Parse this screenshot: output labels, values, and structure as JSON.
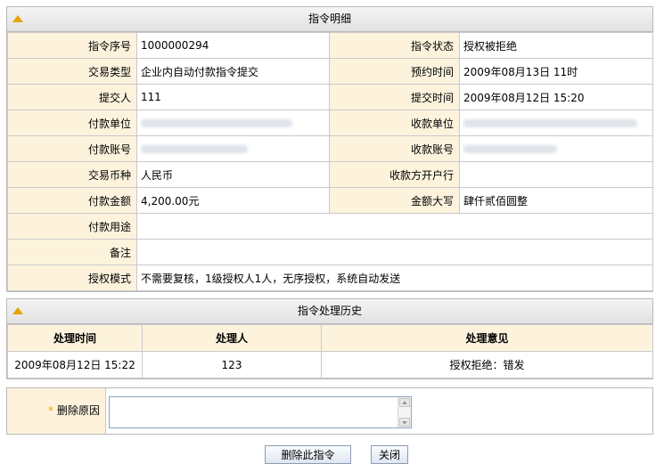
{
  "detail": {
    "title": "指令明细",
    "rows": [
      {
        "l1": "指令序号",
        "v1": "1000000294",
        "l2": "指令状态",
        "v2": "授权被拒绝"
      },
      {
        "l1": "交易类型",
        "v1": "企业内自动付款指令提交",
        "l2": "预约时间",
        "v2": "2009年08月13日 11时"
      },
      {
        "l1": "提交人",
        "v1": "111",
        "l2": "提交时间",
        "v2": "2009年08月12日 15:20"
      },
      {
        "l1": "付款单位",
        "v1": "",
        "l2": "收款单位",
        "v2": ""
      },
      {
        "l1": "付款账号",
        "v1": "",
        "l2": "收款账号",
        "v2": ""
      },
      {
        "l1": "交易币种",
        "v1": "人民币",
        "l2": "收款方开户行",
        "v2": ""
      },
      {
        "l1": "付款金额",
        "v1": "4,200.00元",
        "l2": "金额大写",
        "v2": "肆仟贰佰圆整"
      }
    ],
    "purpose_label": "付款用途",
    "purpose_value": "",
    "remark_label": "备注",
    "remark_value": "",
    "auth_label": "授权模式",
    "auth_value": "不需要复核，1级授权人1人，无序授权，系统自动发送"
  },
  "history": {
    "title": "指令处理历史",
    "columns": [
      "处理时间",
      "处理人",
      "处理意见"
    ],
    "rows": [
      [
        "2009年08月12日 15:22",
        "123",
        "授权拒绝：错发"
      ]
    ]
  },
  "delete_form": {
    "label": "删除原因",
    "value": ""
  },
  "buttons": {
    "delete": "删除此指令",
    "close": "关闭"
  },
  "colors": {
    "accent": "#e8a100",
    "label_bg": "#fdf3dd",
    "border": "#c9c9c9"
  }
}
